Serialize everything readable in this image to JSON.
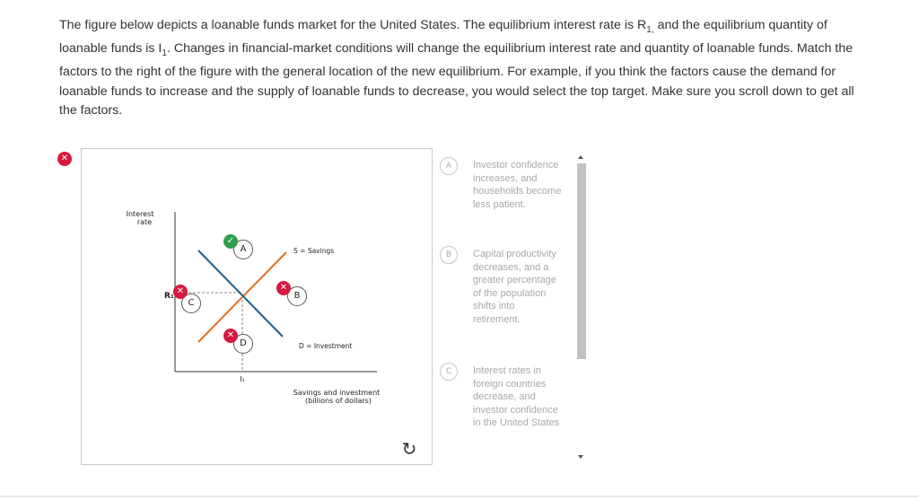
{
  "question": {
    "text": "The figure below depicts a loanable funds market for the United States. The equilibrium interest rate is R",
    "r_sub": "1,",
    "mid_text": " and the equilibrium quantity of loanable funds is I",
    "i_sub": "1",
    "rest_text": ". Changes in financial-market conditions will change the equilibrium interest rate and quantity of loanable funds. Match the factors to the right of the figure with the general location of the new equilibrium. For example, if you think the factors cause the demand for loanable funds to increase and the supply of loanable funds to decrease, you would select the top target. Make sure you scroll down to get all the factors."
  },
  "graph": {
    "y_axis_label_line1": "Interest",
    "y_axis_label_line2": "rate",
    "x_axis_label_line1": "Savings and investment",
    "x_axis_label_line2": "(billions of dollars)",
    "r1_label": "R₁",
    "i1_label": "I₁",
    "supply_label": "S = Savings",
    "demand_label": "D = Investment",
    "supply_color": "#e07020",
    "demand_color": "#1f5f8b",
    "targets": [
      {
        "label": "A",
        "status": "correct"
      },
      {
        "label": "B",
        "status": "incorrect"
      },
      {
        "label": "C",
        "status": "incorrect"
      },
      {
        "label": "D",
        "status": "incorrect"
      }
    ]
  },
  "status": {
    "overall": "incorrect",
    "correct_color": "#2e9e4b",
    "incorrect_color": "#d6183e"
  },
  "icons": {
    "correct": "check-icon",
    "incorrect": "x-icon",
    "reset": "reset-icon",
    "scroll_up": "scroll-up-arrow-icon",
    "scroll_down": "scroll-down-arrow-icon"
  },
  "factors": [
    {
      "badge": "A",
      "text": "Investor confidence increases, and households become less patient."
    },
    {
      "badge": "B",
      "text": "Capital productivity decreases, and a greater percentage of the population shifts into retirement."
    },
    {
      "badge": "C",
      "text": "Interest rates in foreign countries decrease, and investor confidence in the United States"
    }
  ]
}
